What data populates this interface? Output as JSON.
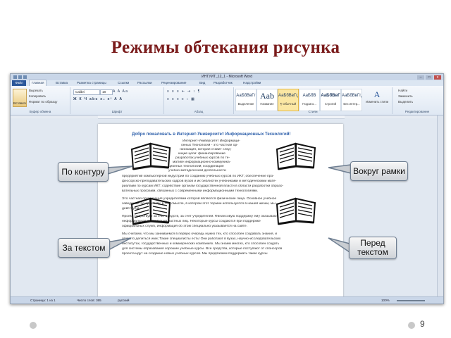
{
  "slide": {
    "title": "Режимы обтекания рисунка",
    "page_number": "9",
    "title_color": "#7a1b1b"
  },
  "word": {
    "window_title": "ИНТУИТ_12_1 - Microsoft Word",
    "window_buttons": [
      "–",
      "□",
      "x"
    ],
    "tabs": [
      "Файл",
      "Главная",
      "Вставка",
      "Разметка страницы",
      "Ссылки",
      "Рассылки",
      "Рецензирование",
      "Вид",
      "Разработчик",
      "Надстройки"
    ],
    "ribbon": {
      "clipboard": {
        "paste": "Вставить",
        "cut": "Вырезать",
        "copy": "Копировать",
        "format_painter": "Формат по образцу",
        "label": "Буфер обмена"
      },
      "font": {
        "name": "Calibri",
        "size": "18",
        "label": "Шрифт",
        "row1_icons": "A A Aa",
        "row2_icons": "Ж К Ч abc x₂ x² A A"
      },
      "paragraph": {
        "label": "Абзац",
        "row1_icons": "≡ ≡ ≡ ⇤ ⇥ ↕ ¶",
        "row2_icons": "≡ ≡ ≡ ≡ ↕ ▦"
      },
      "styles": {
        "label": "Стили",
        "items": [
          {
            "sample": "АаБбВвГг",
            "name": "Выделение"
          },
          {
            "sample": "Aab",
            "name": "Название"
          },
          {
            "sample": "АаБбВвГгД",
            "name": "¶ Обычный"
          },
          {
            "sample": "АаБбВ",
            "name": "Подзаго..."
          },
          {
            "sample": "АаБбВвГ",
            "name": "Строгий"
          },
          {
            "sample": "АаБбВвГгД",
            "name": "Без интер..."
          }
        ],
        "change_styles": "Изменить стили"
      },
      "editing": {
        "find": "Найти",
        "replace": "Заменить",
        "select": "Выделить",
        "label": "Редактирование"
      }
    },
    "document": {
      "heading": "Добро пожаловать в Интернет-Университет Информационных Технологий!",
      "wrapped_lines": [
        "Интернет-Университет   Информаци-",
        "онных Технологий - это частная ор-",
        "ганизация, которая ставит след-",
        "ющие     цели:     финансирование",
        "разработок учебных курсов по те-",
        "матике    информационно-коммуника-",
        "ционных технологий; координация",
        "учебно-методической     деятельности"
      ],
      "full_lines": [
        "предприятий компьютерной индустрии по созданию учебных курсов по ИКТ; обеспечение про-",
        "фессорско-преподавательских кадров вузов и их библиотек учебниками и методическими мате-",
        "риалами по курсам ИКТ; содействие органам государственной власти в области разработки образо-",
        "вательных программ, связанных с современными информационными технологиями.",
        "Это частная организация учредителями которой являются физические лица. Основное учебное",
        "заведение, по существу, в том смысле, в котором этот термин используется в нашей жизни, мы",
        "действуем...",
        "Проект существует за счет средств, за счет учредителей. Финансовую поддержку ему оказывают",
        "неформальная организация частных лиц. Некоторые курсы создаются при поддержке",
        "официальных служб, информация об этом специально указывается на сайте.",
        "Мы считаем, что мы занимаемся в первую очередь нужно тех, кто способен создавать знания, и",
        "открыто делиться ими; Такие специалисты есть! Они работают в вузах, научно-исследовательских",
        "институтах, государственных и коммерческих компаниях. Мы знаем многих, кто способен создать",
        "для системы образования хорошие учебные курсы. Все средства, которые поступают от спонсоров",
        "проекта идут на создание новых учебных курсов. Мы предлагаем поддержать такие курсы"
      ]
    },
    "status": {
      "page": "Страница: 1 из 1",
      "words": "Число слов: 365",
      "language": "русский",
      "zoom": "100%"
    }
  },
  "callouts": {
    "contour": "По контуру",
    "frame": "Вокруг рамки",
    "behind": "За текстом",
    "front": "Перед текстом"
  }
}
